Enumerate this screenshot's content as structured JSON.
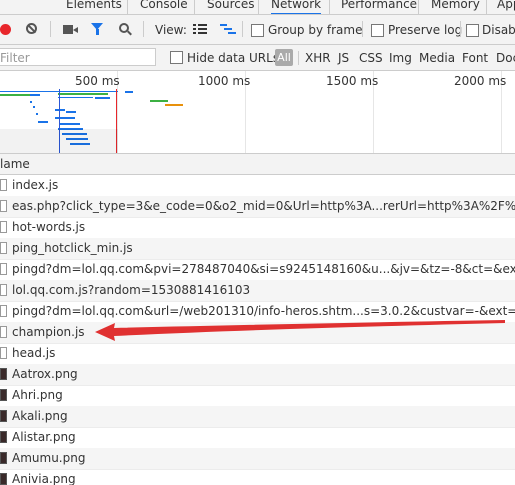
{
  "tabs": [
    "Elements",
    "Console",
    "Sources",
    "Network",
    "Performance",
    "Memory",
    "App"
  ],
  "active_tab": "Network",
  "toolbar": {
    "view_label": "View:",
    "group_by_frame": "Group by frame",
    "preserve_log": "Preserve log",
    "disable_cache": "Disab"
  },
  "filterbar": {
    "placeholder": "Filter",
    "hide_data_urls": "Hide data URLs",
    "all": "All",
    "types": [
      "XHR",
      "JS",
      "CSS",
      "Img",
      "Media",
      "Font",
      "Doc"
    ]
  },
  "overview": {
    "ticks": [
      "500 ms",
      "1000 ms",
      "1500 ms",
      "2000 ms"
    ]
  },
  "column_header": "lame",
  "rows": [
    {
      "name": "index.js",
      "type": "doc"
    },
    {
      "name": "eas.php?click_type=3&e_code=0&o2_mid=0&Url=http%3A...rerUrl=http%3A%2F%2Flol.qq.com",
      "type": "doc"
    },
    {
      "name": "hot-words.js",
      "type": "doc"
    },
    {
      "name": "ping_hotclick_min.js",
      "type": "doc"
    },
    {
      "name": "pingd?dm=lol.qq.com&pvi=278487040&si=s9245148160&u...&jv=&tz=-8&ct=&ext=adid=&p",
      "type": "doc"
    },
    {
      "name": "lol.qq.com.js?random=1530881416103",
      "type": "doc"
    },
    {
      "name": "pingd?dm=lol.qq.com&url=/web201310/info-heros.shtm...s=3.0.2&custvar=-&ext=4&reserved",
      "type": "doc"
    },
    {
      "name": "champion.js",
      "type": "doc"
    },
    {
      "name": "head.js",
      "type": "doc"
    },
    {
      "name": "Aatrox.png",
      "type": "png"
    },
    {
      "name": "Ahri.png",
      "type": "png"
    },
    {
      "name": "Akali.png",
      "type": "png"
    },
    {
      "name": "Alistar.png",
      "type": "png"
    },
    {
      "name": "Amumu.png",
      "type": "png"
    },
    {
      "name": "Anivia.png",
      "type": "png"
    }
  ],
  "colors": {
    "accent": "#1a73e8",
    "record": "#e8262b",
    "arrow": "#e03131"
  }
}
